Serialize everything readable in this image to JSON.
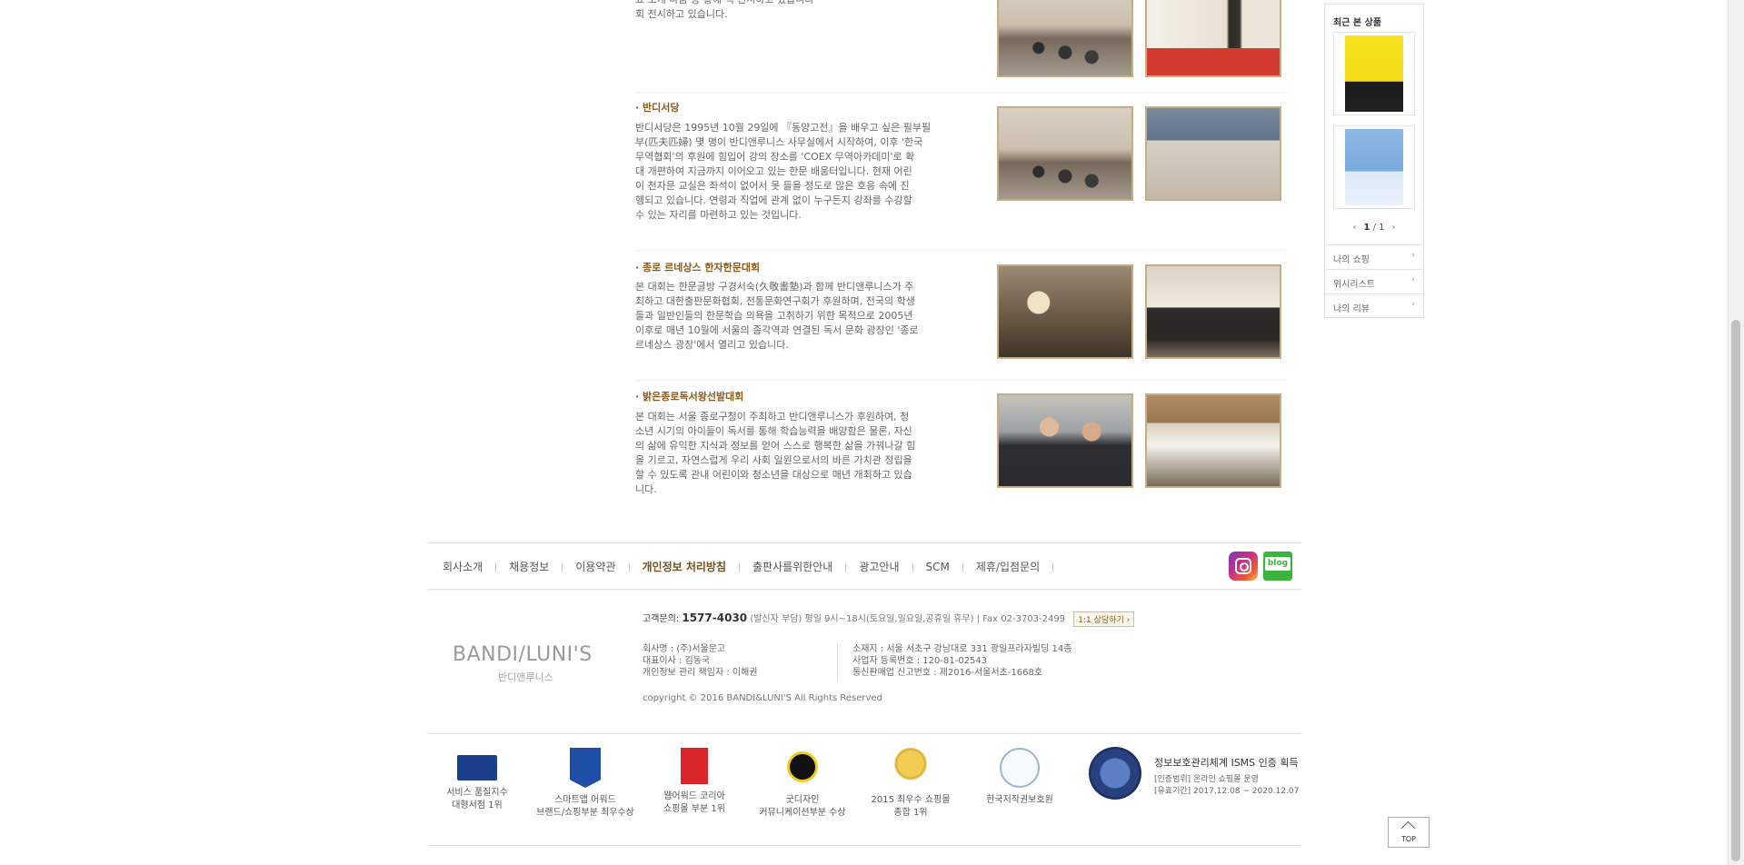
{
  "sections": [
    {
      "title": "",
      "lines": [
        "요 소개 나눔 등 통해 책 전시하고 있습니다",
        "회 전시하고 있습니다."
      ]
    },
    {
      "title": "· 반디서당",
      "lines": [
        "반디서당은 1995년 10월 29일에 『동양고전』을 배우고 싶은 필부필",
        "부(匹夫匹婦) 몇 명이 반디앤루니스 사무실에서 시작하여, 이후 '한국",
        "무역협회'의 후원에 힘입어 강의 장소를 'COEX 무역아카데미'로 확",
        "대 개편하여 지금까지 이어오고 있는 한문 배움터입니다. 현재 어린",
        "이 천자문 교실은 좌석이 없어서 못 들을 정도로 많은 호응 속에 진",
        "행되고 있습니다. 연령과 직업에 관계 없이 누구든지 강좌를 수강할",
        "수 있는 자리를 마련하고 있는 것입니다."
      ]
    },
    {
      "title": "· 종로 르네상스 한자한문대회",
      "lines": [
        "본 대회는 한문글방 구경서숙(久敬書塾)과 함께 반디앤루니스가 주",
        "최하고 대한출판문화협회, 전통문화연구회가 후원하며, 전국의 학생",
        "들과 일반인들의 한문학습 의욕을 고취하기 위한 목적으로 2005년",
        "이후로 매년 10월에 서울의 종각역과 연결된 독서 문화 광장인 '종로",
        "르네상스 광장'에서 열리고 있습니다."
      ]
    },
    {
      "title": "· 밝은종로독서왕선발대회",
      "lines": [
        "본 대회는 서울 종로구청이 주최하고 반디앤루니스가 후원하여, 청",
        "소년 시기의 아이들이 독서를 통해 학습능력을 배양함은 물론, 자신",
        "의 삶에 유익한 지식과 정보를 얻어 스스로 행복한 삶을 가꿔나갈 힘",
        "을 기르고, 자연스럽게 우리 사회 일원으로서의 바른 가치관 정립을",
        "할 수 있도록 관내 어린이와 청소년을 대상으로 매년 개최하고 있습",
        "니다."
      ]
    }
  ],
  "footer_nav": {
    "links": [
      "회사소개",
      "채용정보",
      "이용약관",
      "개인정보 처리방침",
      "출판사를위한안내",
      "광고안내",
      "SCM",
      "제휴/입점문의"
    ],
    "instagram_icon": "instagram-icon",
    "blog_label": "blog"
  },
  "customer_service": {
    "label": "고객문의:",
    "phone": "1577-4030",
    "note": "(발신자 부담) 평일 9시~18시(토요일,일요일,공휴일 휴무) | Fax 02-3703-2499",
    "chat_button": "1:1 상담하기 ›"
  },
  "logo": {
    "main": "BANDI/LUNI'S",
    "sub": "반디앤루니스"
  },
  "company_info": {
    "left": [
      "회사명 : (주)서울문고",
      "대표이사 : 김동국",
      "개인정보 관리 책임자 : 이해권"
    ],
    "right": [
      "소재지 : 서울 서초구 강남대로 331 광일프라자빌딩 14층",
      "사업자 등록번호 : 120-81-02543",
      "통신판매업 신고번호 : 제2016-서울서초-1668호"
    ]
  },
  "copyright": "copyright © 2016 BANDI&LUNI'S All Rights Reserved",
  "awards": [
    {
      "line1": "서비스 품질지수",
      "line2": "대형서점 1위"
    },
    {
      "line1": "스마트앱 어워드",
      "line2": "브랜드/쇼핑부분 최우수상"
    },
    {
      "line1": "웹어워드 코리아",
      "line2": "쇼핑몰 부분 1위"
    },
    {
      "line1": "굿디자인",
      "line2": "커뮤니케이션부분 수상"
    },
    {
      "line1": "2015 최우수 쇼핑몰",
      "line2": "종합 1위"
    },
    {
      "line1": "한국저작권보호원",
      "line2": ""
    }
  ],
  "isms": {
    "title": "정보보호관리체계 ISMS 인증 획득",
    "scope": "[인증범위] 온라인 쇼핑몰 운영",
    "period": "[유효기간] 2017.12.08 ~ 2020.12.07"
  },
  "top_button": "TOP",
  "recent_panel": {
    "title": "최근 본 상품",
    "pager_current": "1",
    "pager_total": "/ 1",
    "links": [
      "나의 쇼핑",
      "위시리스트",
      "나의 리뷰"
    ]
  },
  "colors": {
    "accent_brown": "#8a5a1c",
    "photo_border": "#c8ad84",
    "blog_green": "#3bb53b"
  }
}
